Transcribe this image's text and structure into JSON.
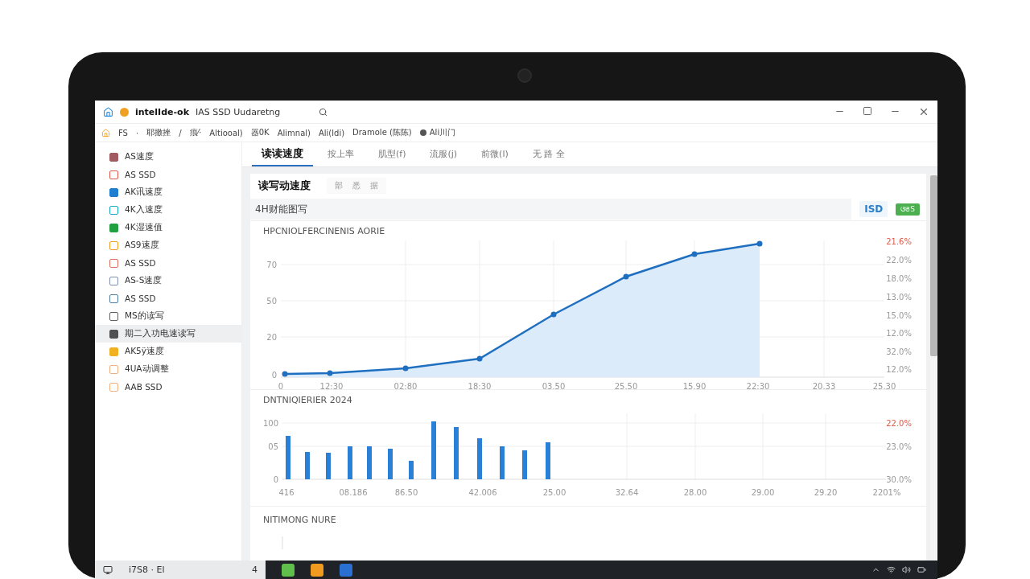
{
  "window": {
    "app": "intelIde-ok",
    "title": "IAS SSD Uudaretng"
  },
  "menu": [
    {
      "kind": "text",
      "label": "FS"
    },
    {
      "kind": "text",
      "label": "·"
    },
    {
      "kind": "text",
      "label": "耶撤挫"
    },
    {
      "kind": "text",
      "label": "/"
    },
    {
      "kind": "text",
      "label": "痕⁄·"
    },
    {
      "kind": "text",
      "label": "Altiooal)"
    },
    {
      "kind": "text",
      "label": "器0K"
    },
    {
      "kind": "text",
      "label": "Alimnal)"
    },
    {
      "kind": "text",
      "label": "Ali(ldi)"
    },
    {
      "kind": "text",
      "label": "Dramole (陈陈)"
    },
    {
      "kind": "dot",
      "label": "Ali川门"
    }
  ],
  "sidebar": {
    "items": [
      {
        "label": "AS速度",
        "color": "#a05a60",
        "kind": "filled",
        "selected": false
      },
      {
        "label": "AS SSD",
        "color": "#e05a4a",
        "kind": "outline",
        "selected": false
      },
      {
        "label": "AK讯速度",
        "color": "#1e7fd0",
        "kind": "filled",
        "selected": false
      },
      {
        "label": "4K入速度",
        "color": "#1aa8c8",
        "kind": "outline",
        "selected": false
      },
      {
        "label": "4K湿速值",
        "color": "#20a040",
        "kind": "filled",
        "selected": false
      },
      {
        "label": "AS9速度",
        "color": "#f0a020",
        "kind": "outline",
        "selected": false
      },
      {
        "label": "AS SSD",
        "color": "#e07060",
        "kind": "outline",
        "selected": false
      },
      {
        "label": "AS-S速度",
        "color": "#8090b0",
        "kind": "outline",
        "selected": false
      },
      {
        "label": "AS SSD",
        "color": "#5080a0",
        "kind": "outline",
        "selected": false
      },
      {
        "label": "MS的读写",
        "color": "#606060",
        "kind": "outline",
        "selected": false
      },
      {
        "label": "期二入功电速读写",
        "color": "#505050",
        "kind": "filled",
        "selected": true
      },
      {
        "label": "AK5ÿ速度",
        "color": "#f0b020",
        "kind": "filled",
        "selected": false
      },
      {
        "label": "4UA动调整",
        "color": "#f0b080",
        "kind": "outline",
        "selected": false
      },
      {
        "label": "AAB SSD",
        "color": "#f0b080",
        "kind": "outline",
        "selected": false
      }
    ]
  },
  "tabs": [
    {
      "label": "读读速度",
      "selected": true
    },
    {
      "label": "按上率",
      "selected": false
    },
    {
      "label": "肌型(f)",
      "selected": false
    },
    {
      "label": "流服(j)",
      "selected": false
    },
    {
      "label": "前微(l)",
      "selected": false
    },
    {
      "label": "无 路 全",
      "selected": false
    }
  ],
  "card": {
    "title": "读写动速度",
    "subtabs": [
      "部",
      "悉",
      "据"
    ],
    "field": {
      "value": "4H财能图写"
    },
    "tag": "ISD",
    "badge": "ଓଞS"
  },
  "charts": [
    {
      "kind": "line",
      "title": "HPCNIOLFERCINENIS AORIE",
      "y_labels": [
        "70",
        "50",
        "20",
        "0"
      ],
      "right_labels": [
        {
          "text": "21.6%",
          "color": "#e05a4a"
        },
        {
          "text": "22.0%",
          "color": "#999999"
        },
        {
          "text": "18.0%",
          "color": "#999999"
        },
        {
          "text": "13.0%",
          "color": "#999999"
        },
        {
          "text": "15.0%",
          "color": "#999999"
        },
        {
          "text": "12.0%",
          "color": "#999999"
        },
        {
          "text": "32.0%",
          "color": "#999999"
        },
        {
          "text": "12.0%",
          "color": "#999999"
        }
      ],
      "x_labels": [
        "0",
        "12:30",
        "02:80",
        "18:30",
        "03.50",
        "25.50",
        "15.90",
        "22:30",
        "20.33",
        "25.30"
      ]
    },
    {
      "kind": "bar",
      "title": "DNTNIQIERIER 2024",
      "y_labels": [
        "100",
        "05",
        "0"
      ],
      "right_labels": [
        {
          "text": "22.0%",
          "color": "#e05a4a"
        },
        {
          "text": "23.0%",
          "color": "#999999"
        },
        {
          "text": "30.0%",
          "color": "#999999"
        }
      ],
      "x_labels": [
        "416",
        "08.186",
        "86.50",
        "42.006",
        "25.00",
        "32.64",
        "28.00",
        "29.00",
        "29.20",
        "2201%"
      ]
    },
    {
      "kind": "empty",
      "title": "NITIMONG NURE"
    }
  ],
  "taskbar": {
    "label": "i7S8 · El",
    "count": "4"
  }
}
